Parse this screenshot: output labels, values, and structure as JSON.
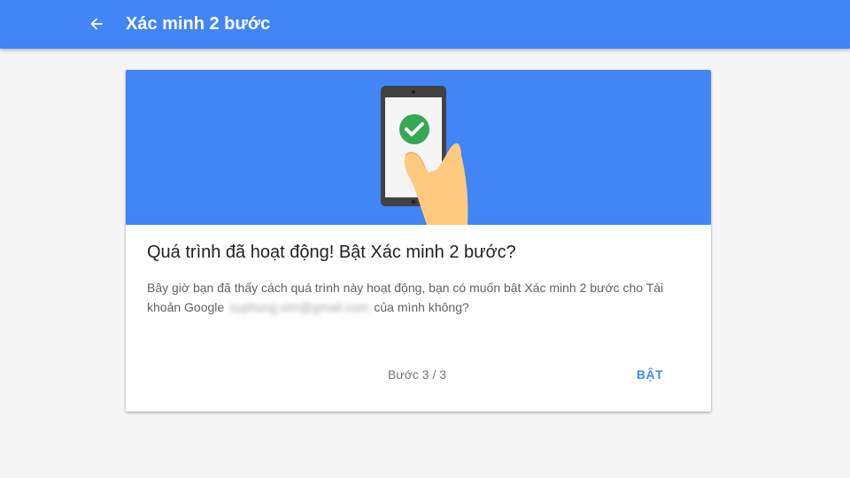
{
  "header": {
    "title": "Xác minh 2 bước",
    "back_icon": "arrow-back-icon"
  },
  "card": {
    "title": "Quá trình đã hoạt động! Bật Xác minh 2 bước?",
    "body_prefix": "Bây giờ bạn đã thấy cách quá trình này hoạt động, bạn có muốn bật Xác minh 2 bước cho Tài khoản Google",
    "email": "xuphung.xim@gmail.com",
    "body_suffix": "của mình không?",
    "step": "Bước 3 / 3",
    "enable_label": "BẬT",
    "illustration_icons": [
      "phone-icon",
      "check-circle-icon",
      "hand-icon"
    ]
  },
  "colors": {
    "primary": "#4285f4",
    "check_green": "#34a853",
    "background": "#f5f5f5"
  }
}
